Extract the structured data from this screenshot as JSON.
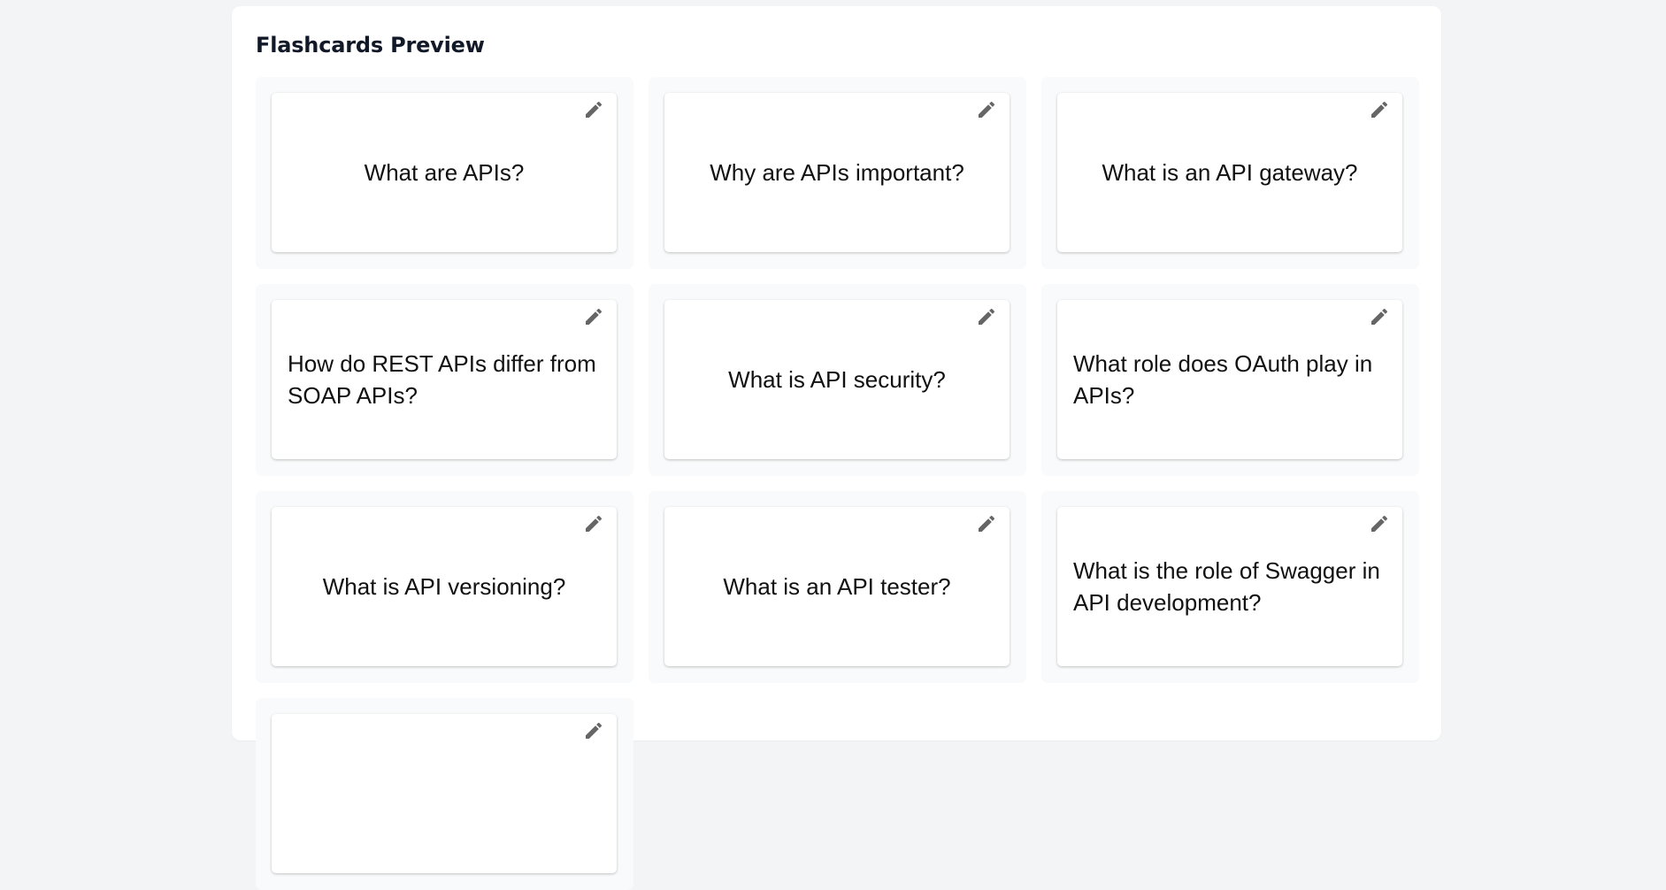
{
  "panel": {
    "title": "Flashcards Preview"
  },
  "icons": {
    "edit": "pencil-icon"
  },
  "colors": {
    "background": "#f3f4f6",
    "panel": "#ffffff",
    "slot": "#f9fafb",
    "title": "#111827",
    "icon": "#666666"
  },
  "cards": [
    {
      "question": "What are APIs?"
    },
    {
      "question": "Why are APIs important?"
    },
    {
      "question": "What is an API gateway?"
    },
    {
      "question": "How do REST APIs differ from SOAP APIs?"
    },
    {
      "question": "What is API security?"
    },
    {
      "question": "What role does OAuth play in APIs?"
    },
    {
      "question": "What is API versioning?"
    },
    {
      "question": "What is an API tester?"
    },
    {
      "question": "What is the role of Swagger in API development?"
    },
    {
      "question": ""
    }
  ]
}
